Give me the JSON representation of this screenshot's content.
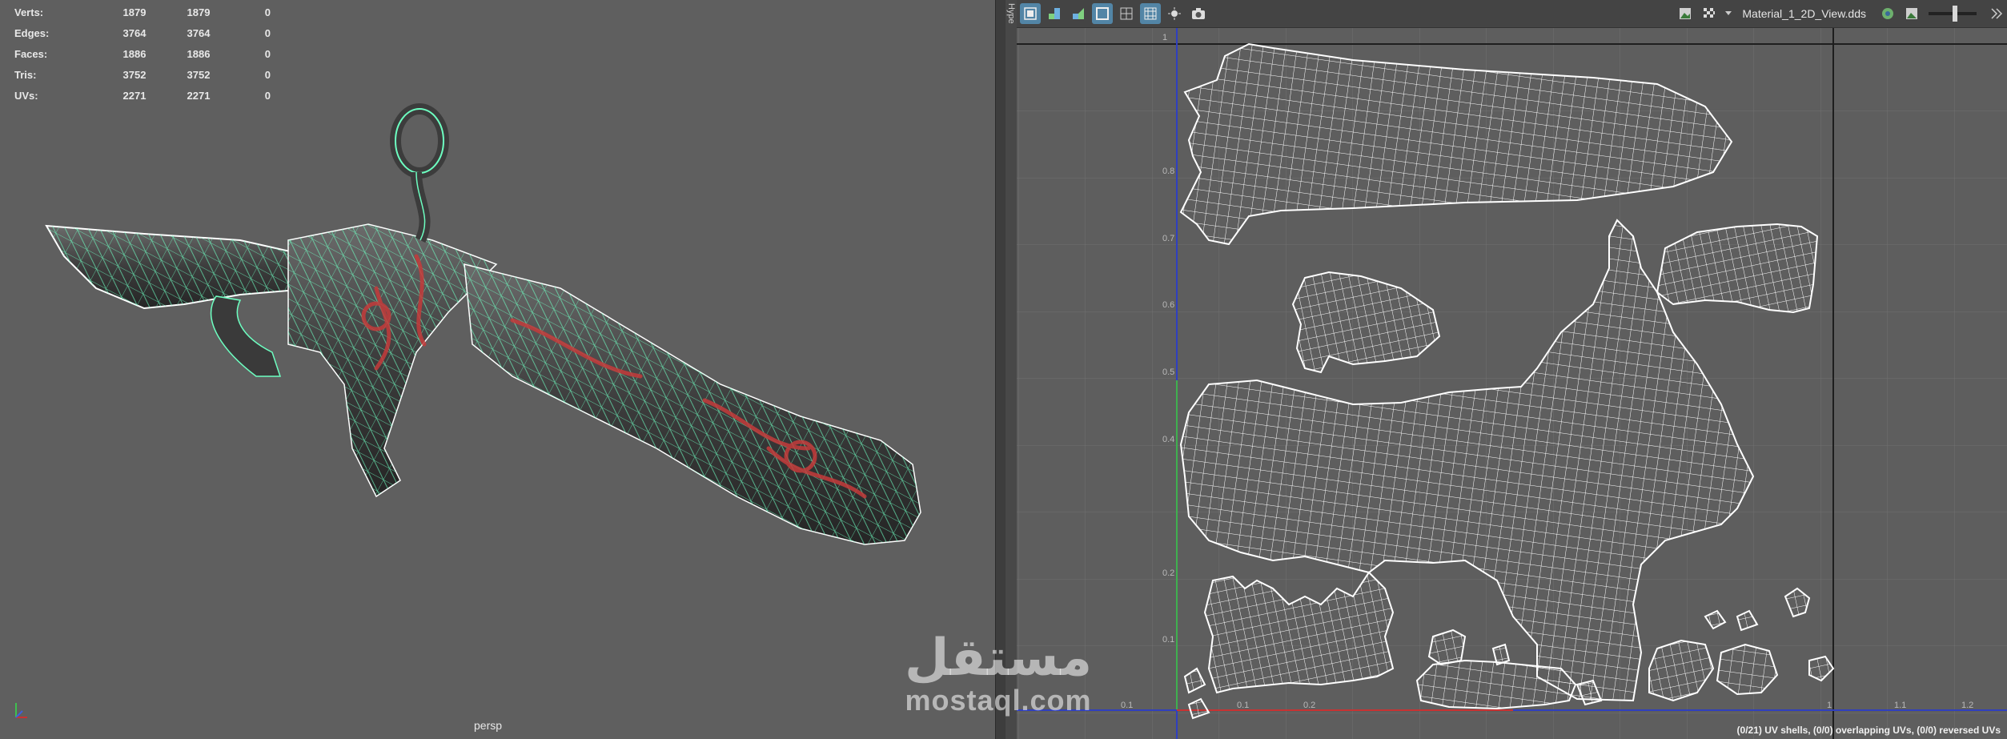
{
  "stats": {
    "rows": [
      {
        "label": "Verts:",
        "v1": "1879",
        "v2": "1879",
        "v3": "0"
      },
      {
        "label": "Edges:",
        "v1": "3764",
        "v2": "3764",
        "v3": "0"
      },
      {
        "label": "Faces:",
        "v1": "1886",
        "v2": "1886",
        "v3": "0"
      },
      {
        "label": "Tris:",
        "v1": "3752",
        "v2": "3752",
        "v3": "0"
      },
      {
        "label": "UVs:",
        "v1": "2271",
        "v2": "2271",
        "v3": "0"
      }
    ]
  },
  "viewport": {
    "camera_label": "persp"
  },
  "uv_editor": {
    "side_label": "Hype",
    "texture_name": "Material_1_2D_View.dds",
    "status": "(0/21) UV shells, (0/0) overlapping UVs, (0/0) reversed UVs",
    "ticks_x": [
      "0.1",
      "0.1",
      "0.2",
      "1",
      "1.1",
      "1.2"
    ],
    "ticks_y": [
      "1",
      "0.8",
      "0.7",
      "0.6",
      "0.5",
      "0.4",
      "0.2",
      "0.1"
    ]
  },
  "watermark": {
    "arabic": "مستقل",
    "latin": "mostaql.com"
  },
  "colors": {
    "uv_wire": "#ffffff",
    "mesh_wire": "#6dffc1",
    "u_axis": "#c83232",
    "v_axis": "#2f3fbf",
    "active_tool": "#5285a6"
  }
}
